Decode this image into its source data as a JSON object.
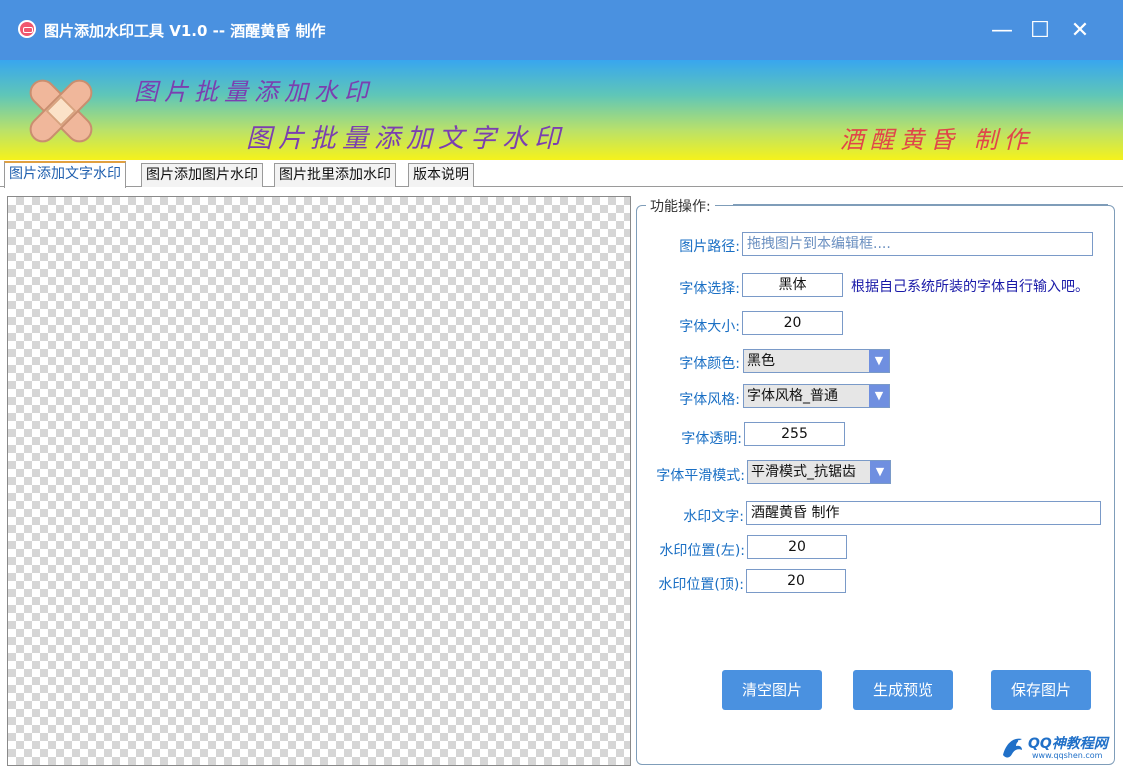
{
  "window": {
    "title": "图片添加水印工具 V1.0 -- 酒醒黄昏 制作",
    "minimize_glyph": "—",
    "maximize_glyph": "☐",
    "close_glyph": "✕"
  },
  "banner": {
    "line1": "图片批量添加水印",
    "line2": "图片批量添加文字水印",
    "author": "酒醒黄昏 制作"
  },
  "tabs": [
    {
      "label": "图片添加文字水印",
      "active": true
    },
    {
      "label": "图片添加图片水印",
      "active": false
    },
    {
      "label": "图片批里添加水印",
      "active": false
    },
    {
      "label": "版本说明",
      "active": false
    }
  ],
  "panel": {
    "group_title": "功能操作:",
    "image_path": {
      "label": "图片路径:",
      "value": "拖拽图片到本编辑框...."
    },
    "font_select": {
      "label": "字体选择:",
      "value": "黑体",
      "hint": "根据自己系统所装的字体自行输入吧。"
    },
    "font_size": {
      "label": "字体大小:",
      "value": "20"
    },
    "font_color": {
      "label": "字体颜色:",
      "value": "黑色"
    },
    "font_style": {
      "label": "字体风格:",
      "value": "字体风格_普通"
    },
    "font_alpha": {
      "label": "字体透明:",
      "value": "255"
    },
    "smooth_mode": {
      "label": "字体平滑模式:",
      "value": "平滑模式_抗锯齿"
    },
    "watermark_text": {
      "label": "水印文字:",
      "value": "酒醒黄昏 制作"
    },
    "pos_left": {
      "label": "水印位置(左):",
      "value": "20"
    },
    "pos_top": {
      "label": "水印位置(顶):",
      "value": "20"
    }
  },
  "buttons": {
    "clear": "清空图片",
    "preview": "生成预览",
    "save": "保存图片"
  },
  "site_watermark": {
    "main": "QQ神教程网",
    "sub": "www.qqshen.com"
  },
  "colors": {
    "titlebar": "#4a91e0",
    "accent_text": "#1a6fc4",
    "button": "#4a91e0",
    "banner_author": "#e0464a",
    "banner_title": "#7b3fb0"
  }
}
